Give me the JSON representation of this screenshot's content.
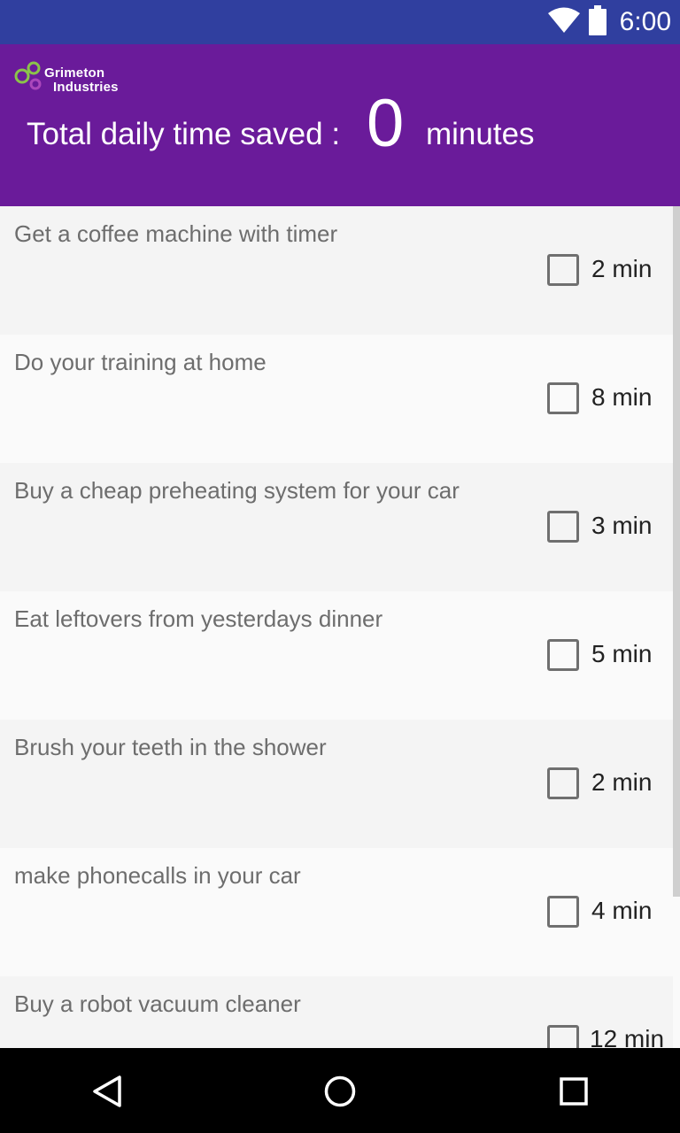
{
  "status_bar": {
    "time": "6:00",
    "icons": [
      "wifi-icon",
      "battery-icon"
    ]
  },
  "header": {
    "logo_line1": "Grimeton",
    "logo_line2": "Industries",
    "label": "Total daily time saved :",
    "count": "0",
    "unit": "minutes",
    "background": "#6a1b9a"
  },
  "items": [
    {
      "title": "Get a coffee machine with timer",
      "time": "2 min",
      "checked": false
    },
    {
      "title": "Do your training at home",
      "time": "8 min",
      "checked": false
    },
    {
      "title": "Buy a cheap preheating system for your car",
      "time": "3 min",
      "checked": false
    },
    {
      "title": "Eat leftovers from yesterdays dinner",
      "time": "5 min",
      "checked": false
    },
    {
      "title": "Brush your teeth in the shower",
      "time": "2 min",
      "checked": false
    },
    {
      "title": "make phonecalls in your car",
      "time": "4 min",
      "checked": false
    },
    {
      "title": "Buy a robot vacuum cleaner",
      "time": "12 min",
      "checked": false
    }
  ],
  "nav_bar": {
    "icons": [
      "back-icon",
      "home-icon",
      "recents-icon"
    ]
  },
  "colors": {
    "status_bar": "#303f9f",
    "header": "#6a1b9a",
    "row_alt": "#f4f4f4",
    "row": "#fafafa"
  }
}
